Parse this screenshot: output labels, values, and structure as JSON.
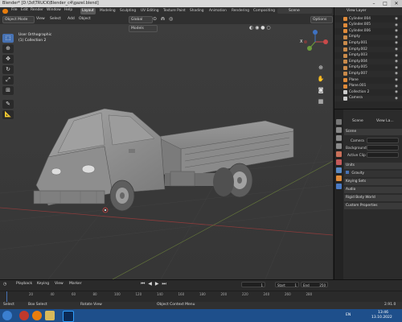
{
  "window": {
    "title": "Blender* [D:\\3d\\TRUCK\\Blender_c4\\gazel.blend]",
    "controls": [
      "–",
      "□",
      "✕"
    ]
  },
  "menubar": {
    "menus": [
      "File",
      "Edit",
      "Render",
      "Window",
      "Help"
    ],
    "workspaces": [
      "Layout",
      "Modeling",
      "Sculpting",
      "UV Editing",
      "Texture Paint",
      "Shading",
      "Animation",
      "Rendering",
      "Compositing"
    ],
    "active_workspace": "Layout",
    "scene_label": "Scene",
    "view_layer_label": "View Layer"
  },
  "viewport_header": {
    "mode": "Object Mode",
    "menus": [
      "View",
      "Select",
      "Add",
      "Object"
    ],
    "transform_orientation": "Global",
    "options": "Options",
    "models_dropdown": "Models"
  },
  "viewport": {
    "view_name": "User Orthographic",
    "collection": "(1) Collection 2",
    "gizmo": {
      "x": "X",
      "y": "Y",
      "z": "Z"
    }
  },
  "toolbar": {
    "tools": [
      "select-box",
      "cursor",
      "move",
      "rotate",
      "scale",
      "transform",
      "annotate",
      "measure"
    ]
  },
  "outliner": {
    "items": [
      {
        "name": "Cylinder.004",
        "selected": false
      },
      {
        "name": "Cylinder.005",
        "selected": false
      },
      {
        "name": "Cylinder.006",
        "selected": false
      },
      {
        "name": "Empty",
        "selected": false
      },
      {
        "name": "Empty.001",
        "selected": false
      },
      {
        "name": "Empty.002",
        "selected": false
      },
      {
        "name": "Empty.003",
        "selected": false
      },
      {
        "name": "Empty.004",
        "selected": false
      },
      {
        "name": "Empty.005",
        "selected": false
      },
      {
        "name": "Empty.007",
        "selected": false
      },
      {
        "name": "Plane",
        "selected": false
      },
      {
        "name": "Plane.001",
        "selected": false
      },
      {
        "name": "Collection 2",
        "selected": false
      },
      {
        "name": "Camera",
        "selected": false
      }
    ]
  },
  "properties": {
    "scene_name": "Scene",
    "view_label": "View La...",
    "panels": {
      "scene": "Scene",
      "camera_label": "Camera",
      "background_label": "Background",
      "active_clip_label": "Active Clip",
      "units": "Units",
      "gravity": "Gravity",
      "keying_sets": "Keying Sets",
      "audio": "Audio",
      "rigid_body_world": "Rigid Body World",
      "custom_properties": "Custom Properties"
    }
  },
  "timeline": {
    "menus": [
      "Playback",
      "Keying",
      "View",
      "Marker"
    ],
    "current_frame": "1",
    "start_label": "Start",
    "start_value": "1",
    "end_label": "End",
    "end_value": "250",
    "ticks": [
      "20",
      "40",
      "60",
      "80",
      "100",
      "120",
      "140",
      "160",
      "180",
      "200",
      "220",
      "240",
      "260",
      "280"
    ]
  },
  "statusbar": {
    "select": "Select",
    "box_select": "Box Select",
    "rotate_view": "Rotate View",
    "context_menu": "Object Context Menu",
    "version": "2.91.0"
  },
  "taskbar": {
    "time": "13:46",
    "date": "13.10.2022",
    "language": "EN"
  },
  "colors": {
    "accent": "#4772b3",
    "object_orange": "#e08b3a",
    "viewport_bg": "#3a3a3a",
    "taskbar": "#1e4f8b"
  }
}
